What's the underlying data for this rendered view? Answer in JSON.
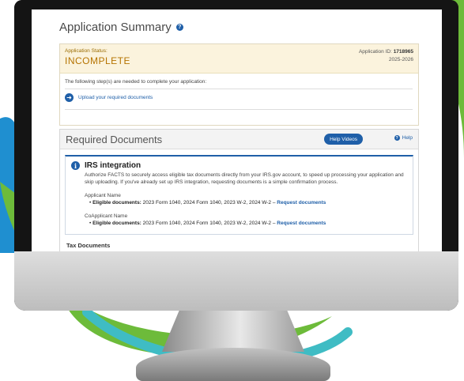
{
  "page": {
    "title": "Application Summary"
  },
  "status": {
    "label": "Application Status:",
    "value": "INCOMPLETE",
    "app_id_label": "Application ID:",
    "app_id_value": "1718965",
    "year": "2025-2026",
    "steps_text": "The following step(s) are needed to complete your application:",
    "upload_link": "Upload your required documents"
  },
  "required_docs": {
    "title": "Required Documents",
    "help_videos": "Help Videos",
    "help": "Help",
    "irs": {
      "title": "IRS integration",
      "description": "Authorize FACTS to securely access eligible tax documents directly from your IRS.gov account, to speed up processing your application and skip uploading. If you've already set up IRS integration, requesting documents is a simple confirmation process.",
      "applicant_name": "Applicant Name",
      "applicant_docs_label": "Eligible documents:",
      "applicant_docs": "2023 Form 1040, 2024 Form 1040, 2023 W-2, 2024 W-2 –",
      "coapplicant_name": "CoApplicant Name",
      "coapplicant_docs_label": "Eligible documents:",
      "coapplicant_docs": "2023 Form 1040, 2024 Form 1040, 2023 W-2, 2024 W-2 –",
      "request_link": "Request documents"
    },
    "tax_documents": "Tax Documents"
  },
  "colors": {
    "accent": "#1f5fa8",
    "status_orange": "#b57300",
    "green_decor": "#6dbb3a",
    "teal_decor": "#3fbcc4",
    "blue_decor": "#1f8fd0"
  }
}
